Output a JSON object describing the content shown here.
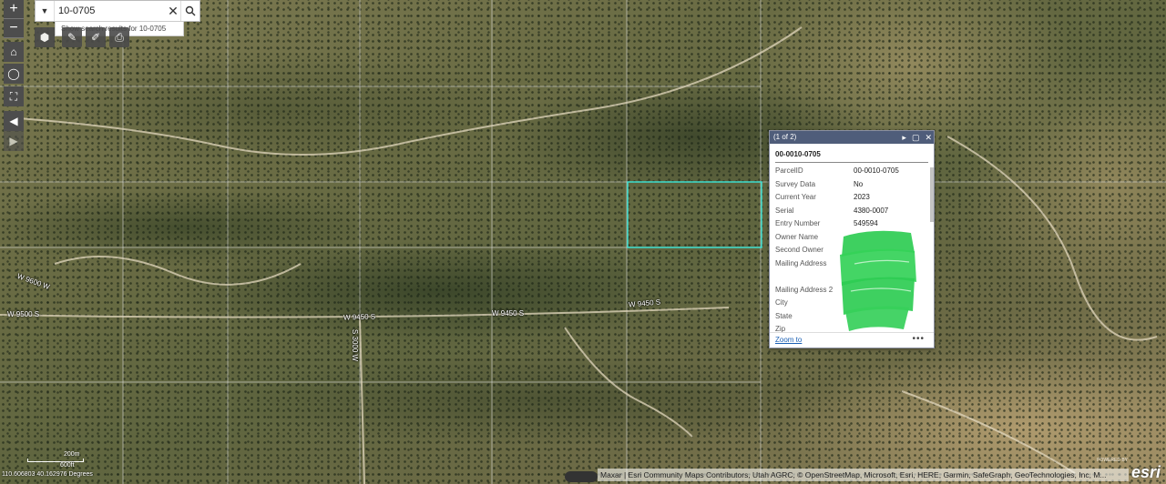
{
  "search": {
    "value": "10-0705",
    "suggestion": "Show search results for 10-0705"
  },
  "zoom": {
    "in": "+",
    "out": "−"
  },
  "popup": {
    "counter": "(1 of 2)",
    "title": "00-0010-0705",
    "attributes": [
      {
        "key": "ParcelID",
        "value": "00-0010-0705"
      },
      {
        "key": "Survey Data",
        "value": "No"
      },
      {
        "key": "Current Year",
        "value": "2023"
      },
      {
        "key": "Serial",
        "value": "4380-0007"
      },
      {
        "key": "Entry Number",
        "value": "549594"
      },
      {
        "key": "Owner Name",
        "value": ""
      },
      {
        "key": "Second Owner",
        "value": ""
      },
      {
        "key": "Mailing Address",
        "value": ""
      },
      {
        "key": "",
        "value": ""
      },
      {
        "key": "Mailing Address 2",
        "value": ""
      },
      {
        "key": "City",
        "value": ""
      },
      {
        "key": "State",
        "value": ""
      },
      {
        "key": "Zip",
        "value": ""
      }
    ],
    "zoom_to": "Zoom to",
    "more": "•••",
    "redaction_color": "#2ecc52"
  },
  "roads": {
    "r1": "W 9500 S",
    "r2": "W 9450 S",
    "r3": "W 9450 S",
    "r4": "W 9450 S",
    "r5": "S 3000 W",
    "r6": "W 9600 W"
  },
  "footer": {
    "attribution": "Maxar | Esri Community Maps Contributors, Utah AGRC, © OpenStreetMap, Microsoft, Esri, HERE, Garmin, SafeGraph, GeoTechnologies, Inc, M...",
    "coordinates": "110.606803 40.162976 Degrees",
    "scale_top": "200m",
    "scale_bottom": "600ft",
    "logo": "esri",
    "powered": "POWERED BY"
  },
  "colors": {
    "parcel_outline": "#3fe0d0",
    "popup_header": "#4f5d7a",
    "link": "#1a5fb4"
  }
}
